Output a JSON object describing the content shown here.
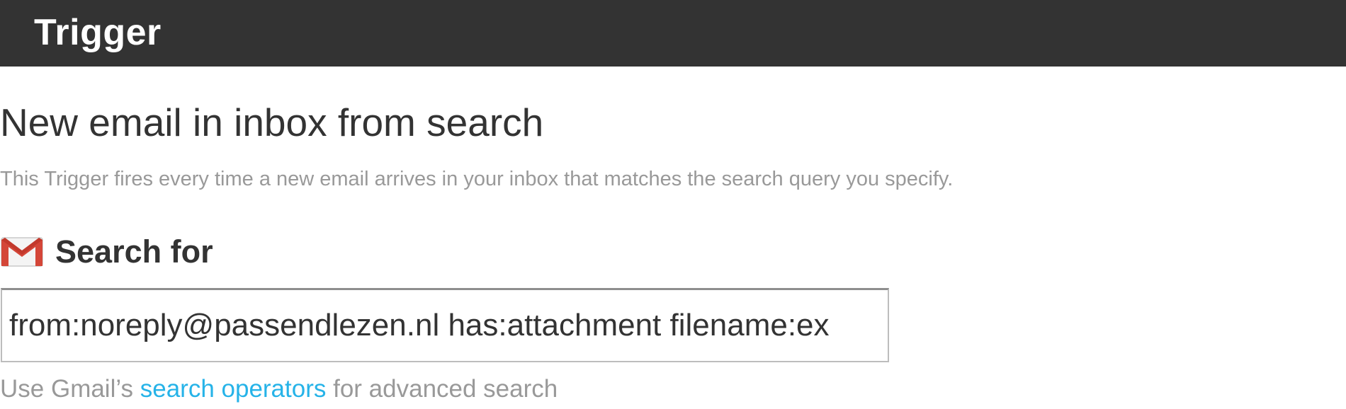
{
  "header": {
    "title": "Trigger"
  },
  "trigger": {
    "name": "New email in inbox from search",
    "description": "This Trigger fires every time a new email arrives in your inbox that matches the search query you specify."
  },
  "field": {
    "icon": "gmail-icon",
    "label": "Search for",
    "value": "from:noreply@passendlezen.nl has:attachment filename:ex",
    "helper_prefix": "Use Gmail’s ",
    "helper_link": "search operators",
    "helper_suffix": " for advanced search"
  },
  "colors": {
    "header_bg": "#333333",
    "link": "#26b3e8",
    "muted_text": "#999999",
    "gmail_red": "#d44638"
  }
}
